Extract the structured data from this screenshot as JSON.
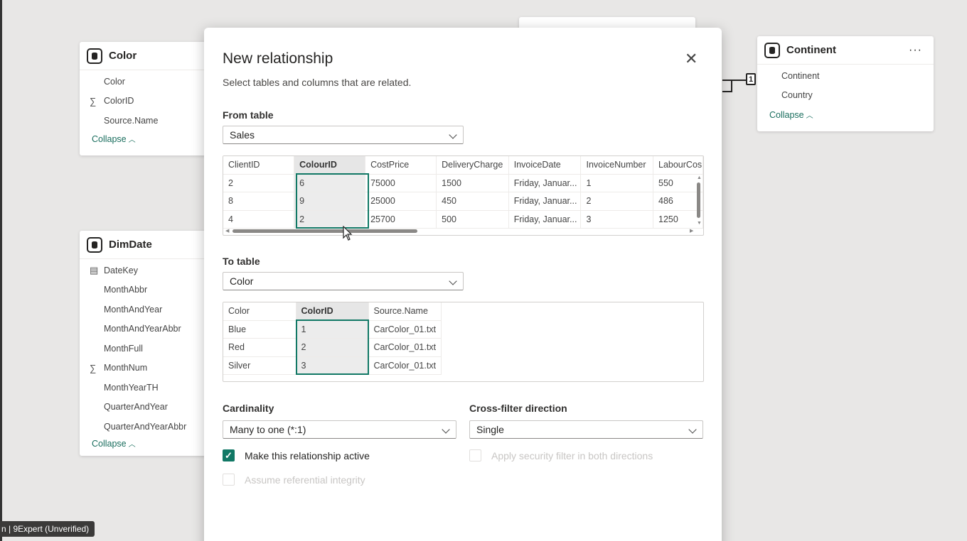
{
  "canvas": {
    "color_table": {
      "title": "Color",
      "fields": [
        {
          "name": "Color",
          "icon": ""
        },
        {
          "name": "ColorID",
          "icon": "∑"
        },
        {
          "name": "Source.Name",
          "icon": ""
        }
      ],
      "collapse_label": "Collapse"
    },
    "dimdate_table": {
      "title": "DimDate",
      "fields": [
        {
          "name": "DateKey",
          "icon": "calendar"
        },
        {
          "name": "MonthAbbr",
          "icon": ""
        },
        {
          "name": "MonthAndYear",
          "icon": ""
        },
        {
          "name": "MonthAndYearAbbr",
          "icon": ""
        },
        {
          "name": "MonthFull",
          "icon": ""
        },
        {
          "name": "MonthNum",
          "icon": "∑"
        },
        {
          "name": "MonthYearTH",
          "icon": ""
        },
        {
          "name": "QuarterAndYear",
          "icon": ""
        },
        {
          "name": "QuarterAndYearAbbr",
          "icon": ""
        }
      ],
      "collapse_label": "Collapse"
    },
    "continent_table": {
      "title": "Continent",
      "more": "···",
      "fields": [
        {
          "name": "Continent"
        },
        {
          "name": "Country"
        }
      ],
      "collapse_label": "Collapse"
    },
    "relationship_marker": "1"
  },
  "dialog": {
    "title": "New relationship",
    "subtitle": "Select tables and columns that are related.",
    "close": "✕",
    "from_label": "From table",
    "from_value": "Sales",
    "from_grid": {
      "columns": [
        "ClientID",
        "ColourID",
        "CostPrice",
        "DeliveryCharge",
        "InvoiceDate",
        "InvoiceNumber",
        "LabourCos"
      ],
      "selected_column": 1,
      "rows": [
        [
          "2",
          "6",
          "75000",
          "1500",
          "Friday, Januar...",
          "1",
          "550"
        ],
        [
          "8",
          "9",
          "25000",
          "450",
          "Friday, Januar...",
          "2",
          "486"
        ],
        [
          "4",
          "2",
          "25700",
          "500",
          "Friday, Januar...",
          "3",
          "1250"
        ]
      ]
    },
    "to_label": "To table",
    "to_value": "Color",
    "to_grid": {
      "columns": [
        "Color",
        "ColorID",
        "Source.Name"
      ],
      "selected_column": 1,
      "rows": [
        [
          "Blue",
          "1",
          "CarColor_01.txt"
        ],
        [
          "Red",
          "2",
          "CarColor_01.txt"
        ],
        [
          "Silver",
          "3",
          "CarColor_01.txt"
        ]
      ]
    },
    "cardinality_label": "Cardinality",
    "cardinality_value": "Many to one (*:1)",
    "crossfilter_label": "Cross-filter direction",
    "crossfilter_value": "Single",
    "make_active_label": "Make this relationship active",
    "make_active_checked": true,
    "security_label": "Apply security filter in both directions",
    "referential_label": "Assume referential integrity"
  },
  "watermark": "n | 9Expert (Unverified)",
  "colors": {
    "accent": "#117865",
    "link": "#1a6e5e"
  }
}
